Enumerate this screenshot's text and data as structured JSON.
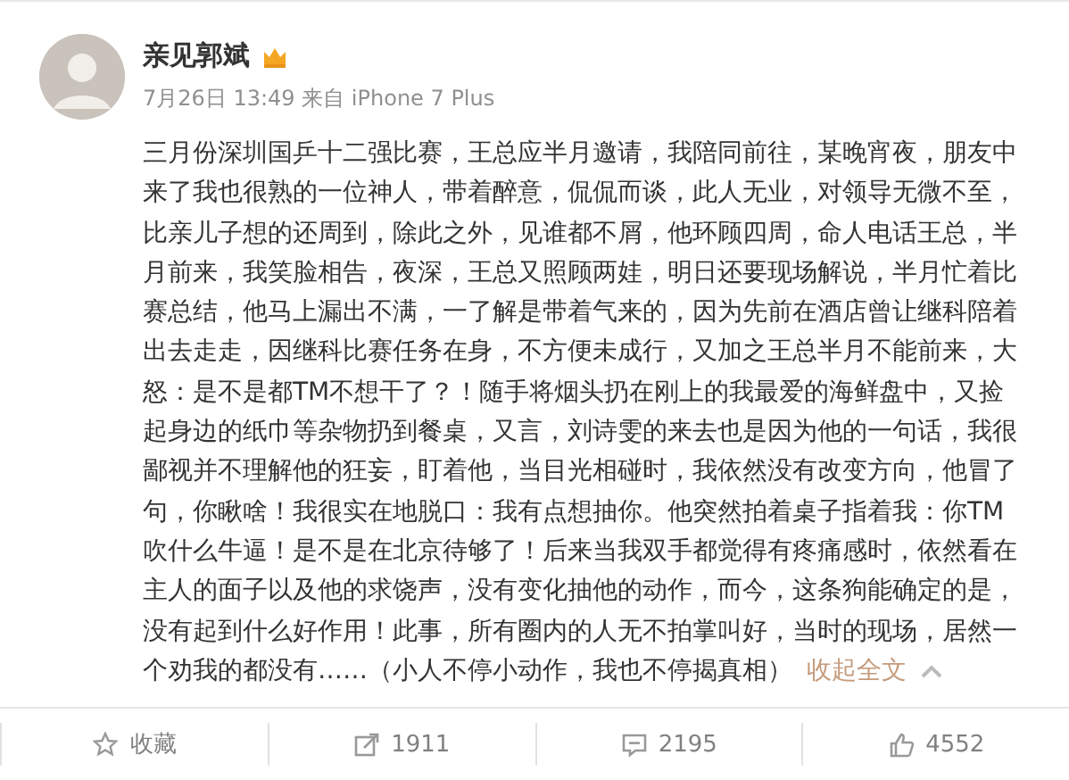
{
  "author": {
    "name": "亲见郭斌",
    "verified": true
  },
  "meta": {
    "time": "7月26日 13:49 来自 iPhone 7 Plus"
  },
  "body": {
    "text": "三月份深圳国乒十二强比赛，王总应半月邀请，我陪同前往，某晚宵夜，朋友中来了我也很熟的一位神人，带着醉意，侃侃而谈，此人无业，对领导无微不至，比亲儿子想的还周到，除此之外，见谁都不屑，他环顾四周，命人电话王总，半月前来，我笑脸相告，夜深，王总又照顾两娃，明日还要现场解说，半月忙着比赛总结，他马上漏出不满，一了解是带着气来的，因为先前在酒店曾让继科陪着出去走走，因继科比赛任务在身，不方便未成行，又加之王总半月不能前来，大怒：是不是都TM不想干了？！随手将烟头扔在刚上的我最爱的海鲜盘中，又捡起身边的纸巾等杂物扔到餐桌，又言，刘诗雯的来去也是因为他的一句话，我很鄙视并不理解他的狂妄，盯着他，当目光相碰时，我依然没有改变方向，他冒了句，你瞅啥！我很实在地脱口：我有点想抽你。他突然拍着桌子指着我：你TM吹什么牛逼！是不是在北京待够了！后来当我双手都觉得有疼痛感时，依然看在主人的面子以及他的求饶声，没有变化抽他的动作，而今，这条狗能确定的是，没有起到什么好作用！此事，所有圈内的人无不拍掌叫好，当时的现场，居然一个劝我的都没有……（小人不停小动作，我也不停揭真相）",
    "collapse_link": "收起全文"
  },
  "actions": [
    {
      "kind": "favorite",
      "label": "收藏"
    },
    {
      "kind": "repost",
      "label": "1911"
    },
    {
      "kind": "comment",
      "label": "2195"
    },
    {
      "kind": "like",
      "label": "4552"
    }
  ]
}
